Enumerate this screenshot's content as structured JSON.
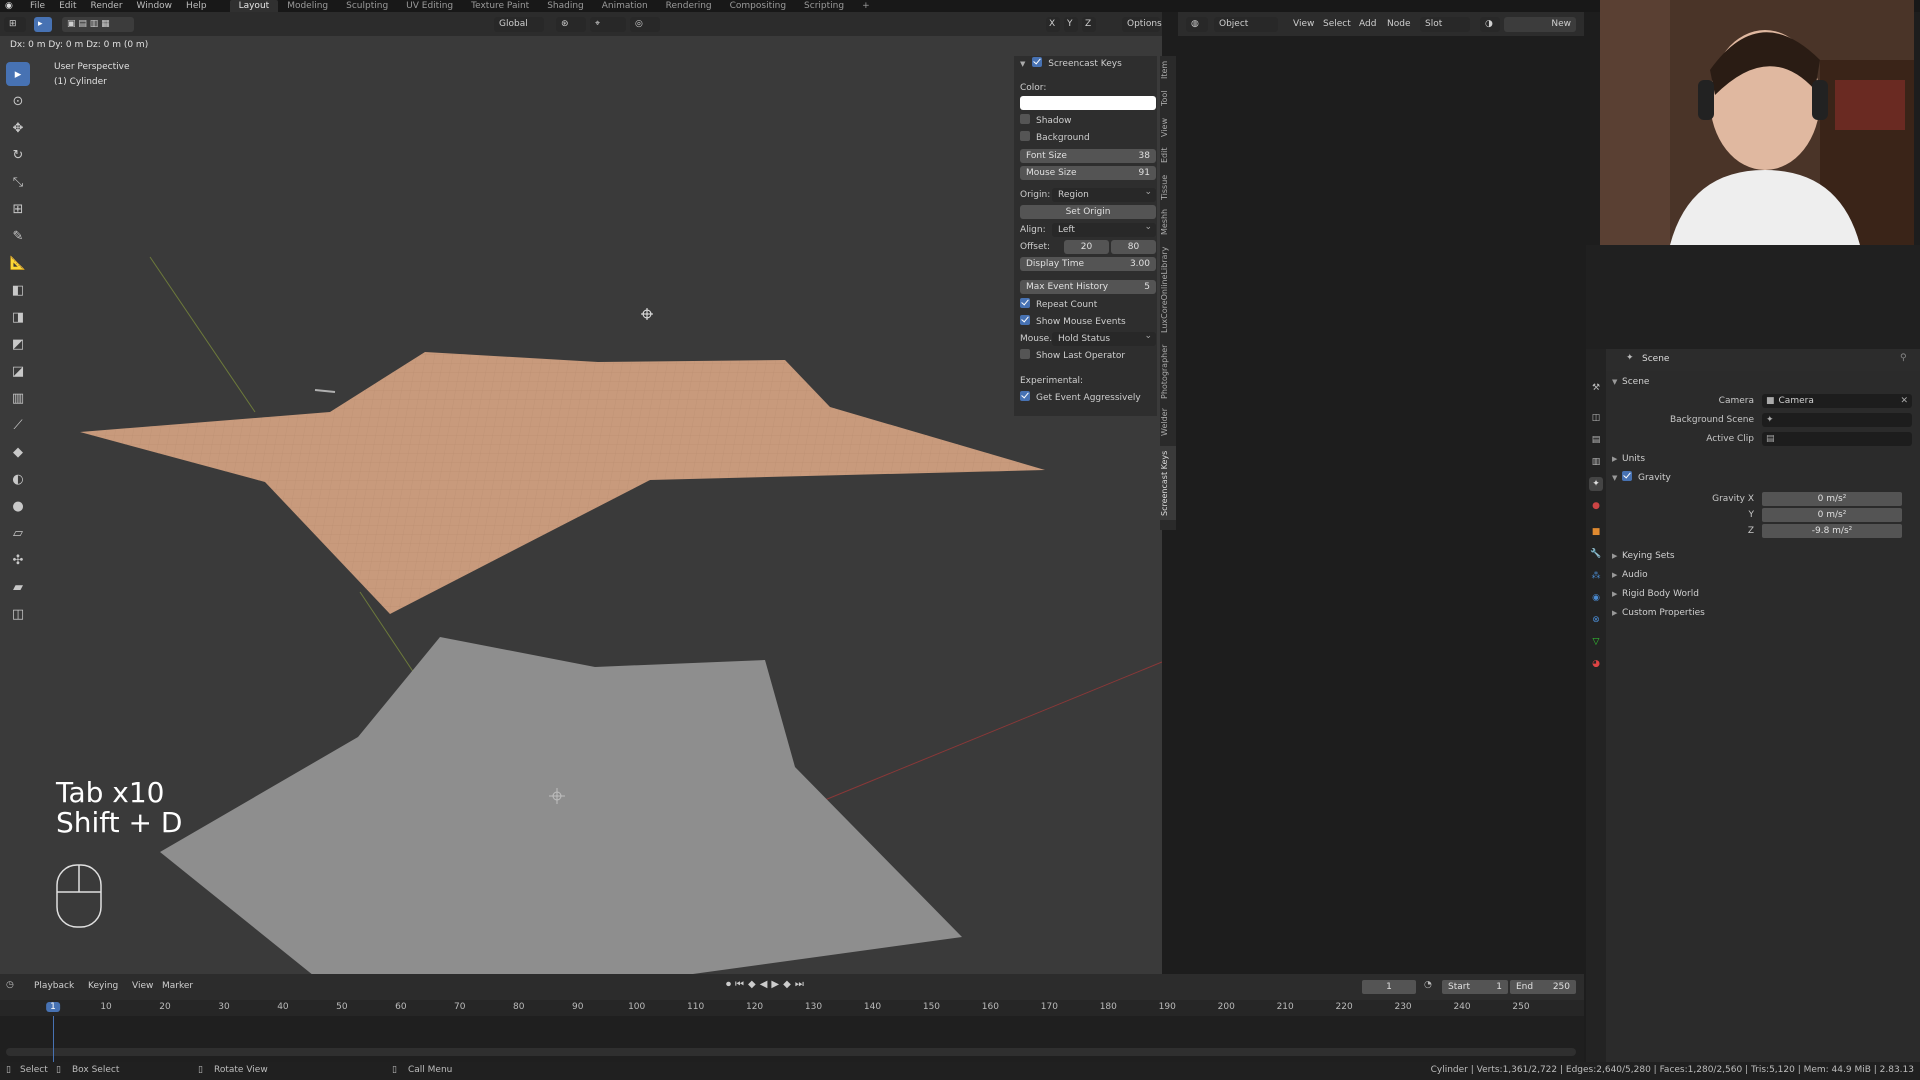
{
  "topbar": {
    "menus": [
      "File",
      "Edit",
      "Render",
      "Window",
      "Help"
    ],
    "workspaces": [
      "Layout",
      "Modeling",
      "Sculpting",
      "UV Editing",
      "Texture Paint",
      "Shading",
      "Animation",
      "Rendering",
      "Compositing",
      "Scripting"
    ],
    "active_workspace": "Layout",
    "add_tab": "+"
  },
  "viewport_header": {
    "transform_orientation": "Global",
    "axes": [
      "X",
      "Y",
      "Z"
    ],
    "options_label": "Options",
    "delta_readout": "Dx: 0 m   Dy: 0 m   Dz: 0 m (0 m)"
  },
  "viewport": {
    "view_name": "User Perspective",
    "object_name": "(1) Cylinder",
    "key_overlay_line1": "Tab x10",
    "key_overlay_line2": "Shift + D"
  },
  "screencast_panel": {
    "title": "Screencast Keys",
    "color_label": "Color:",
    "shadow_label": "Shadow",
    "background_label": "Background",
    "font_size_label": "Font Size",
    "font_size_value": "38",
    "mouse_size_label": "Mouse Size",
    "mouse_size_value": "91",
    "origin_label": "Origin:",
    "origin_value": "Region",
    "set_origin_label": "Set Origin",
    "align_label": "Align:",
    "align_value": "Left",
    "offset_label": "Offset:",
    "offset_x": "20",
    "offset_y": "80",
    "display_time_label": "Display Time",
    "display_time_value": "3.00",
    "max_event_label": "Max Event History",
    "max_event_value": "5",
    "repeat_count_label": "Repeat Count",
    "show_mouse_label": "Show Mouse Events",
    "mouse_mode_label": "Mouse...",
    "mouse_mode_value": "Hold Status",
    "show_last_label": "Show Last Operator",
    "experimental_label": "Experimental:",
    "get_event_label": "Get Event Aggressively"
  },
  "side_tabs": [
    "Item",
    "Tool",
    "View",
    "Edit",
    "Tissue",
    "Meshh",
    "LuxCoreOnlineLibrary",
    "Photographer",
    "Welder",
    "Screencast Keys"
  ],
  "node_header": {
    "object_mode": "Object",
    "menus": [
      "View",
      "Select",
      "Add",
      "Node"
    ],
    "slot_label": "Slot",
    "new_label": "New"
  },
  "properties": {
    "breadcrumb": "Scene",
    "scene_section": "Scene",
    "camera_label": "Camera",
    "camera_value": "Camera",
    "bg_scene_label": "Background Scene",
    "active_clip_label": "Active Clip",
    "units_label": "Units",
    "gravity_label": "Gravity",
    "gravity_x_label": "Gravity X",
    "gravity_x": "0 m/s²",
    "gravity_y_label": "Y",
    "gravity_y": "0 m/s²",
    "gravity_z_label": "Z",
    "gravity_z": "-9.8 m/s²",
    "keying_sets_label": "Keying Sets",
    "audio_label": "Audio",
    "rigid_body_label": "Rigid Body World",
    "custom_props_label": "Custom Properties"
  },
  "timeline": {
    "menus": [
      "Playback",
      "Keying",
      "View",
      "Marker"
    ],
    "current_frame": "1",
    "start_label": "Start",
    "start_value": "1",
    "end_label": "End",
    "end_value": "250",
    "ticks": [
      "1",
      "10",
      "20",
      "30",
      "40",
      "50",
      "60",
      "70",
      "80",
      "90",
      "100",
      "110",
      "120",
      "130",
      "140",
      "150",
      "160",
      "170",
      "180",
      "190",
      "200",
      "210",
      "220",
      "230",
      "240",
      "250"
    ]
  },
  "statusbar": {
    "select": "Select",
    "box_select": "Box Select",
    "rotate_view": "Rotate View",
    "call_menu": "Call Menu",
    "stats": "Cylinder | Verts:1,361/2,722 | Edges:2,640/5,280 | Faces:1,280/2,560 | Tris:5,120 | Mem: 44.9 MiB | 2.83.13"
  },
  "colors": {
    "accent": "#4772b3",
    "plane_orange": "#c89a7c",
    "plane_gray": "#8e8e8e"
  }
}
